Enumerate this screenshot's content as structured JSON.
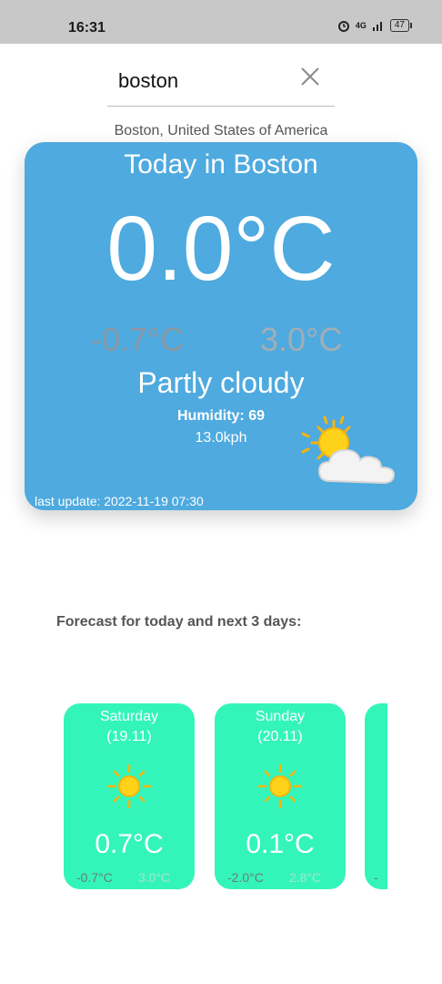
{
  "status_bar": {
    "time": "16:31",
    "network": "4G",
    "battery": "47"
  },
  "search": {
    "value": "boston",
    "placeholder": ""
  },
  "location": {
    "label": "Boston, United States of America"
  },
  "today": {
    "title": "Today in Boston",
    "current_temp": "0.0°C",
    "min_temp": "-0.7°C",
    "max_temp": "3.0°C",
    "condition": "Partly cloudy",
    "humidity": "Humidity: 69",
    "wind": "13.0kph",
    "last_update": "last update: 2022-11-19 07:30",
    "icon": "partly-cloudy-icon"
  },
  "forecast": {
    "heading": "Forecast for today and next 3 days:",
    "days": [
      {
        "day": "Saturday",
        "date": "(19.11)",
        "avg": "0.7°C",
        "min": "-0.7°C",
        "max": "3.0°C",
        "icon": "sun-icon"
      },
      {
        "day": "Sunday",
        "date": "(20.11)",
        "avg": "0.1°C",
        "min": "-2.0°C",
        "max": "2.8°C",
        "icon": "sun-icon"
      },
      {
        "day": "",
        "date": "",
        "avg": "",
        "min": "-",
        "max": "",
        "icon": ""
      }
    ]
  },
  "colors": {
    "card_blue": "#4eaadf",
    "forecast_green": "#33f5b9",
    "status_bar": "#c8c8c8"
  }
}
